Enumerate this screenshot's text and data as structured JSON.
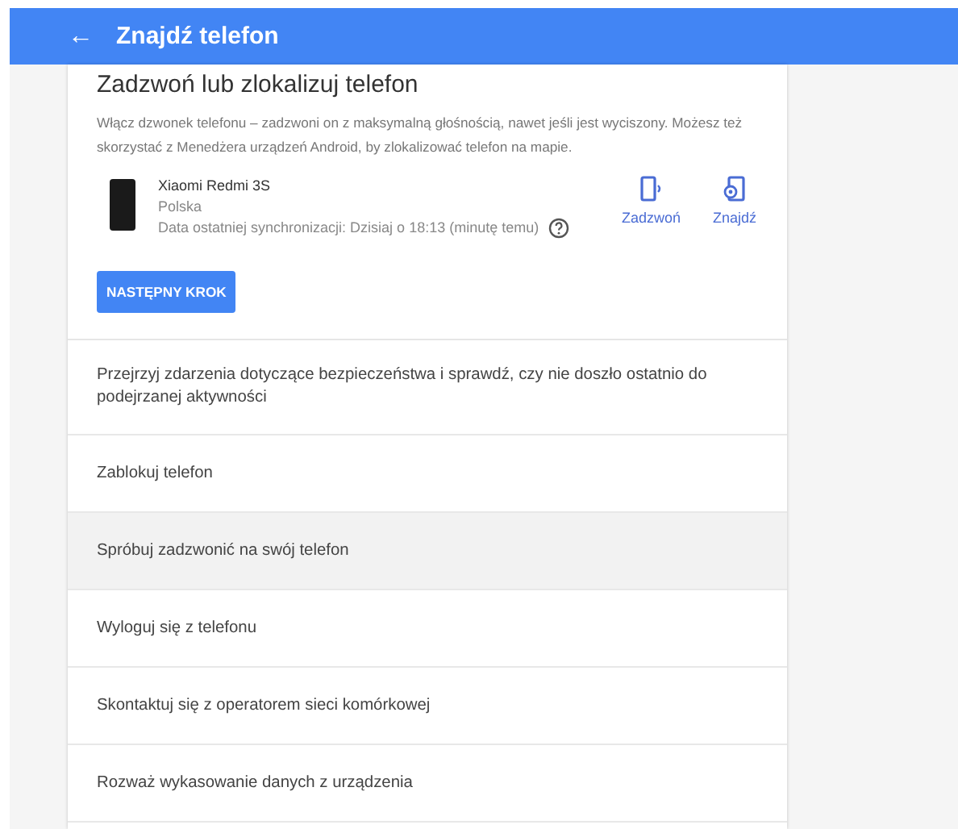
{
  "top_bar": {
    "back": "←",
    "title": "Znajdź telefon"
  },
  "card": {
    "heading": "Zadzwoń lub zlokalizuj telefon",
    "description": "Włącz dzwonek telefonu – zadzwoni on z maksymalną głośnością, nawet jeśli jest wyciszony. Możesz też skorzystać z Menedżera urządzeń Android, by zlokalizować telefon na mapie.",
    "device": {
      "name": "Xiaomi Redmi 3S",
      "country": "Polska",
      "sync": "Data ostatniej synchronizacji: Dzisiaj o 18:13 (minutę temu)"
    },
    "actions": [
      {
        "kind": "ring",
        "label": "Zadzwoń"
      },
      {
        "kind": "locate",
        "label": "Znajdź"
      }
    ],
    "button": "NASTĘPNY KROK"
  },
  "options": [
    {
      "label": "Przejrzyj zdarzenia dotyczące bezpieczeństwa i sprawdź, czy nie doszło ostatnio do podejrzanej aktywności",
      "highlighted": false
    },
    {
      "label": "Zablokuj telefon",
      "highlighted": false
    },
    {
      "label": "Spróbuj zadzwonić na swój telefon",
      "highlighted": true
    },
    {
      "label": "Wyloguj się z telefonu",
      "highlighted": false
    },
    {
      "label": "Skontaktuj się z operatorem sieci komórkowej",
      "highlighted": false
    },
    {
      "label": "Rozważ wykasowanie danych z urządzenia",
      "highlighted": false
    }
  ]
}
